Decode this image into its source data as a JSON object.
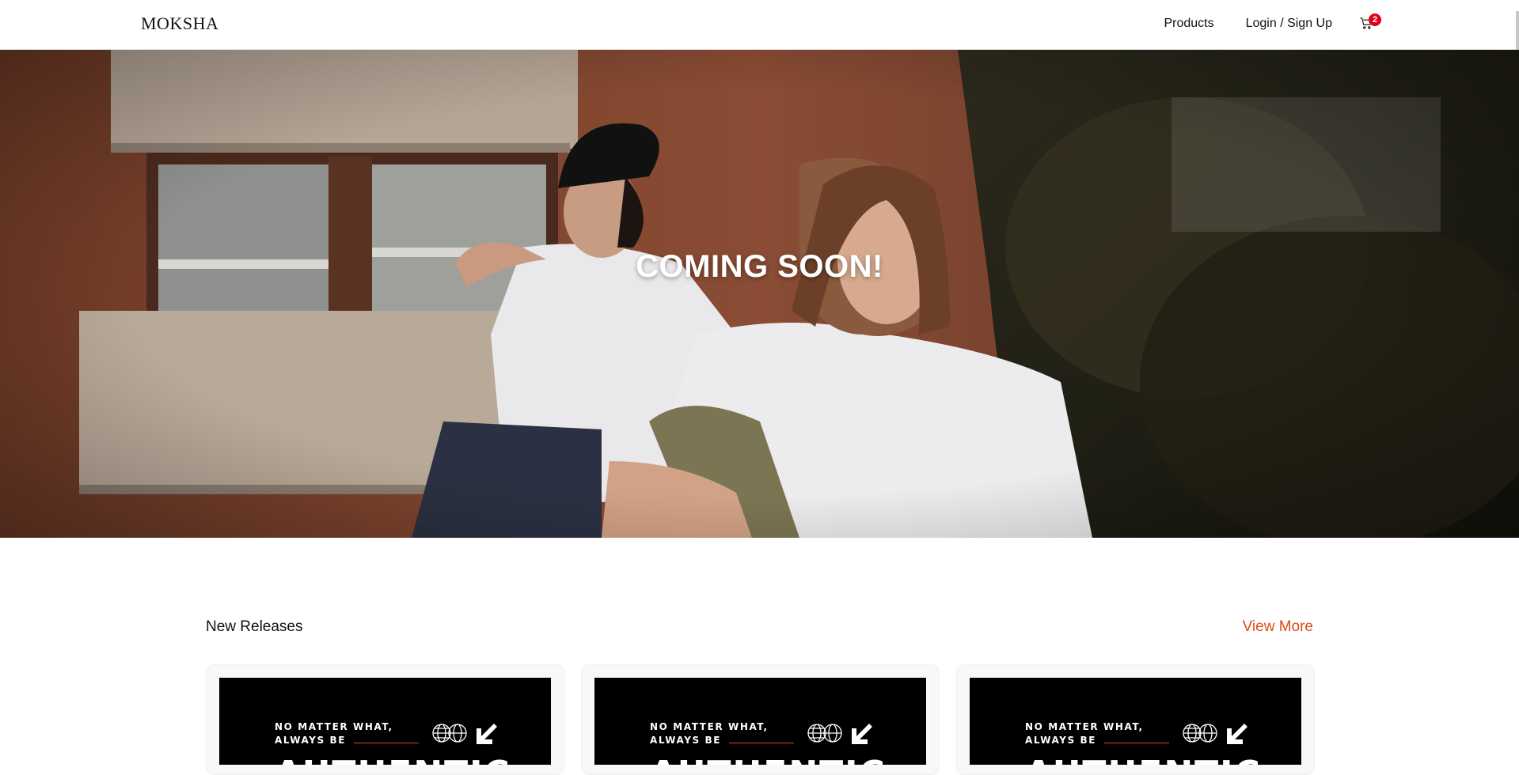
{
  "navbar": {
    "brand": "MOKSHA",
    "links": [
      "Products",
      "Login / Sign Up"
    ],
    "cart_icon": "cart-icon",
    "cart_count": "2"
  },
  "hero": {
    "title": "COMING SOON!",
    "image": "two-models-in-mad-world-tees"
  },
  "new_releases": {
    "title": "New Releases",
    "view_more": "View More",
    "products": [
      {
        "tagline_1": "NO MATTER WHAT,",
        "tagline_2": "ALWAYS BE",
        "headline": "AUTHENTIC"
      },
      {
        "tagline_1": "NO MATTER WHAT,",
        "tagline_2": "ALWAYS BE",
        "headline": "AUTHENTIC"
      },
      {
        "tagline_1": "NO MATTER WHAT,",
        "tagline_2": "ALWAYS BE",
        "headline": "AUTHENTIC"
      }
    ]
  },
  "colors": {
    "accent": "#e0481b",
    "badge": "#e2001a"
  }
}
